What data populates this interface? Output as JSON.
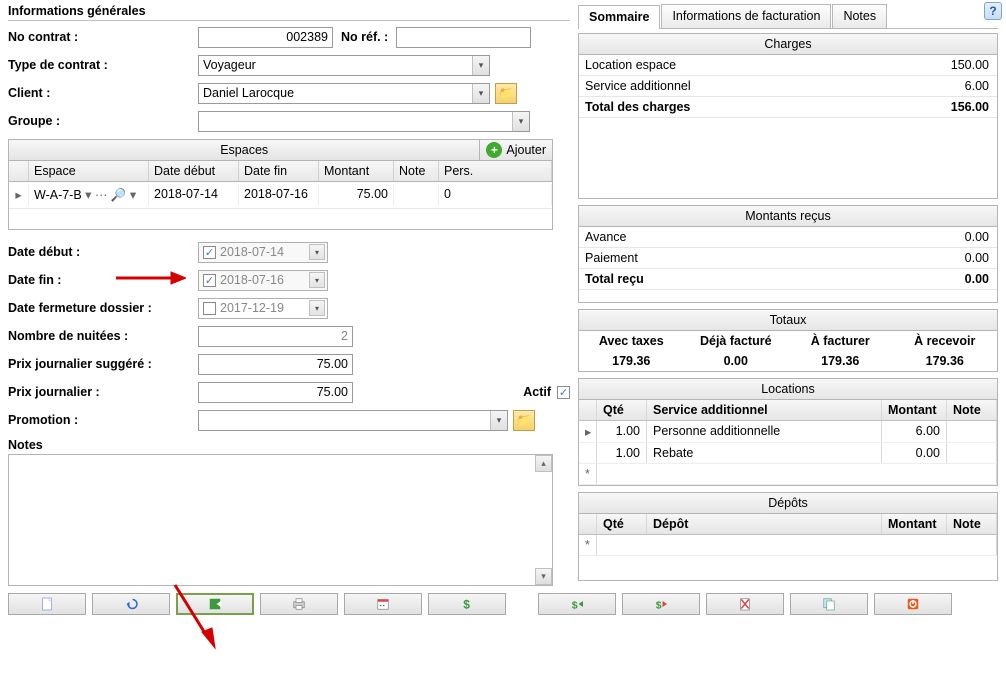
{
  "section_title": "Informations générales",
  "form": {
    "contract_label": "No contrat :",
    "contract_value": "002389",
    "ref_label": "No réf. :",
    "ref_value": "",
    "type_label": "Type de contrat :",
    "type_value": "Voyageur",
    "client_label": "Client :",
    "client_value": "Daniel Larocque",
    "group_label": "Groupe :",
    "group_value": ""
  },
  "spaces_grid": {
    "title": "Espaces",
    "add_label": "Ajouter",
    "columns": {
      "espace": "Espace",
      "date_debut": "Date début",
      "date_fin": "Date fin",
      "montant": "Montant",
      "note": "Note",
      "pers": "Pers."
    },
    "rows": [
      {
        "espace": "W-A-7-B",
        "date_debut": "2018-07-14",
        "date_fin": "2018-07-16",
        "montant": "75.00",
        "note": "",
        "pers": "0"
      }
    ]
  },
  "details": {
    "date_debut_label": "Date début :",
    "date_debut_value": "2018-07-14",
    "date_fin_label": "Date fin :",
    "date_fin_value": "2018-07-16",
    "date_ferm_label": "Date fermeture dossier :",
    "date_ferm_value": "2017-12-19",
    "nights_label": "Nombre de nuitées :",
    "nights_value": "2",
    "prix_sugg_label": "Prix journalier suggéré :",
    "prix_sugg_value": "75.00",
    "prix_label": "Prix journalier :",
    "prix_value": "75.00",
    "actif_label": "Actif",
    "promo_label": "Promotion :",
    "promo_value": "",
    "notes_label": "Notes"
  },
  "tabs": {
    "sommaire": "Sommaire",
    "facturation": "Informations de facturation",
    "notes": "Notes"
  },
  "charges": {
    "header": "Charges",
    "location_label": "Location espace",
    "location_value": "150.00",
    "service_label": "Service additionnel",
    "service_value": "6.00",
    "total_label": "Total des charges",
    "total_value": "156.00"
  },
  "recu": {
    "header": "Montants reçus",
    "avance_label": "Avance",
    "avance_value": "0.00",
    "paiement_label": "Paiement",
    "paiement_value": "0.00",
    "total_label": "Total reçu",
    "total_value": "0.00"
  },
  "totaux": {
    "header": "Totaux",
    "avec_taxes_label": "Avec taxes",
    "avec_taxes_value": "179.36",
    "deja_label": "Déjà facturé",
    "deja_value": "0.00",
    "afacturer_label": "À facturer",
    "afacturer_value": "179.36",
    "arecevoir_label": "À recevoir",
    "arecevoir_value": "179.36"
  },
  "locations": {
    "header": "Locations",
    "columns": {
      "qte": "Qté",
      "service": "Service additionnel",
      "montant": "Montant",
      "note": "Note"
    },
    "rows": [
      {
        "qte": "1.00",
        "service": "Personne additionnelle",
        "montant": "6.00",
        "note": ""
      },
      {
        "qte": "1.00",
        "service": "Rebate",
        "montant": "0.00",
        "note": ""
      }
    ]
  },
  "depots": {
    "header": "Dépôts",
    "columns": {
      "qte": "Qté",
      "depot": "Dépôt",
      "montant": "Montant",
      "note": "Note"
    }
  }
}
